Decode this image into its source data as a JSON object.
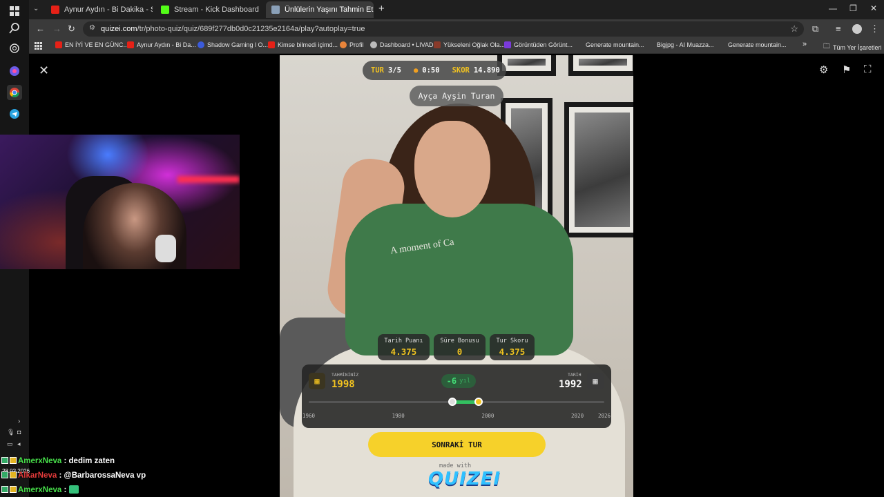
{
  "browser": {
    "tabs": [
      {
        "label": "Aynur Aydın - Bi Dakika - Si",
        "icon": "youtube-icon",
        "color": "#e62117"
      },
      {
        "label": "Stream - Kick Dashboard",
        "icon": "kick-icon",
        "color": "#53fc18"
      },
      {
        "label": "Ünlülerin Yaşını Tahmin Et! - Qu",
        "icon": "quizei-icon",
        "color": "#8aa0b8"
      }
    ],
    "url_host": "quizei.com",
    "url_path": "/tr/photo-quiz/quiz/689f277db0d0c21235e2164a/play?autoplay=true",
    "bookmarks": [
      {
        "label": "EN İYİ VE EN GÜNC...",
        "color": "#e62117"
      },
      {
        "label": "Aynur Aydın - Bi Da...",
        "color": "#e62117"
      },
      {
        "label": "Shadow Gaming l O...",
        "color": "#3b5bdb"
      },
      {
        "label": "Kimse bilmedi içimd...",
        "color": "#e62117"
      },
      {
        "label": "Profil",
        "color": "#e8843a"
      },
      {
        "label": "Dashboard • LIVAD",
        "color": "#bbbbbb"
      },
      {
        "label": "Yükseleni Oğlak Ola...",
        "color": "#8a3a2a"
      },
      {
        "label": "Görüntüden Görünt...",
        "color": "#7a3adb"
      },
      {
        "label": "Generate mountain...",
        "color": ""
      },
      {
        "label": "Bigjpg - AI Muazza...",
        "color": ""
      },
      {
        "label": "Generate mountain...",
        "color": ""
      }
    ],
    "all_bookmarks_label": "Tüm Yer İşaretleri"
  },
  "quiz": {
    "round_label": "TUR",
    "round_value": "3/5",
    "timer": "0:50",
    "score_label": "SKOR",
    "score_value": "14.890",
    "celebrity_name": "Ayça Ayşin Turan",
    "shirt_text": "A moment of Ca",
    "cards": [
      {
        "label": "Tarih Puanı",
        "value": "4.375"
      },
      {
        "label": "Süre Bonusu",
        "value": "0"
      },
      {
        "label": "Tur Skoru",
        "value": "4.375"
      }
    ],
    "guess_label": "TAHMİNİNİZ",
    "guess_value": "1998",
    "actual_label": "TARİH",
    "actual_value": "1992",
    "diff_value": "-6",
    "diff_unit": "yıl",
    "slider_min": 1960,
    "slider_max": 2026,
    "ticks": [
      "1960",
      "1980",
      "2000",
      "2020",
      "2026"
    ],
    "next_button": "SONRAKİ TUR",
    "made_with": "made with",
    "brand": "QUIZEI"
  },
  "chat": {
    "date": "28.02.2026",
    "messages": [
      {
        "user": "AmerxNeva",
        "color": "#47e04a",
        "text": "dedim zaten"
      },
      {
        "user": "AlkarNeva",
        "color": "#e23a3a",
        "text": "@BarbarossaNeva vp"
      },
      {
        "user": "AmerxNeva",
        "color": "#47e04a",
        "text": ""
      }
    ]
  }
}
